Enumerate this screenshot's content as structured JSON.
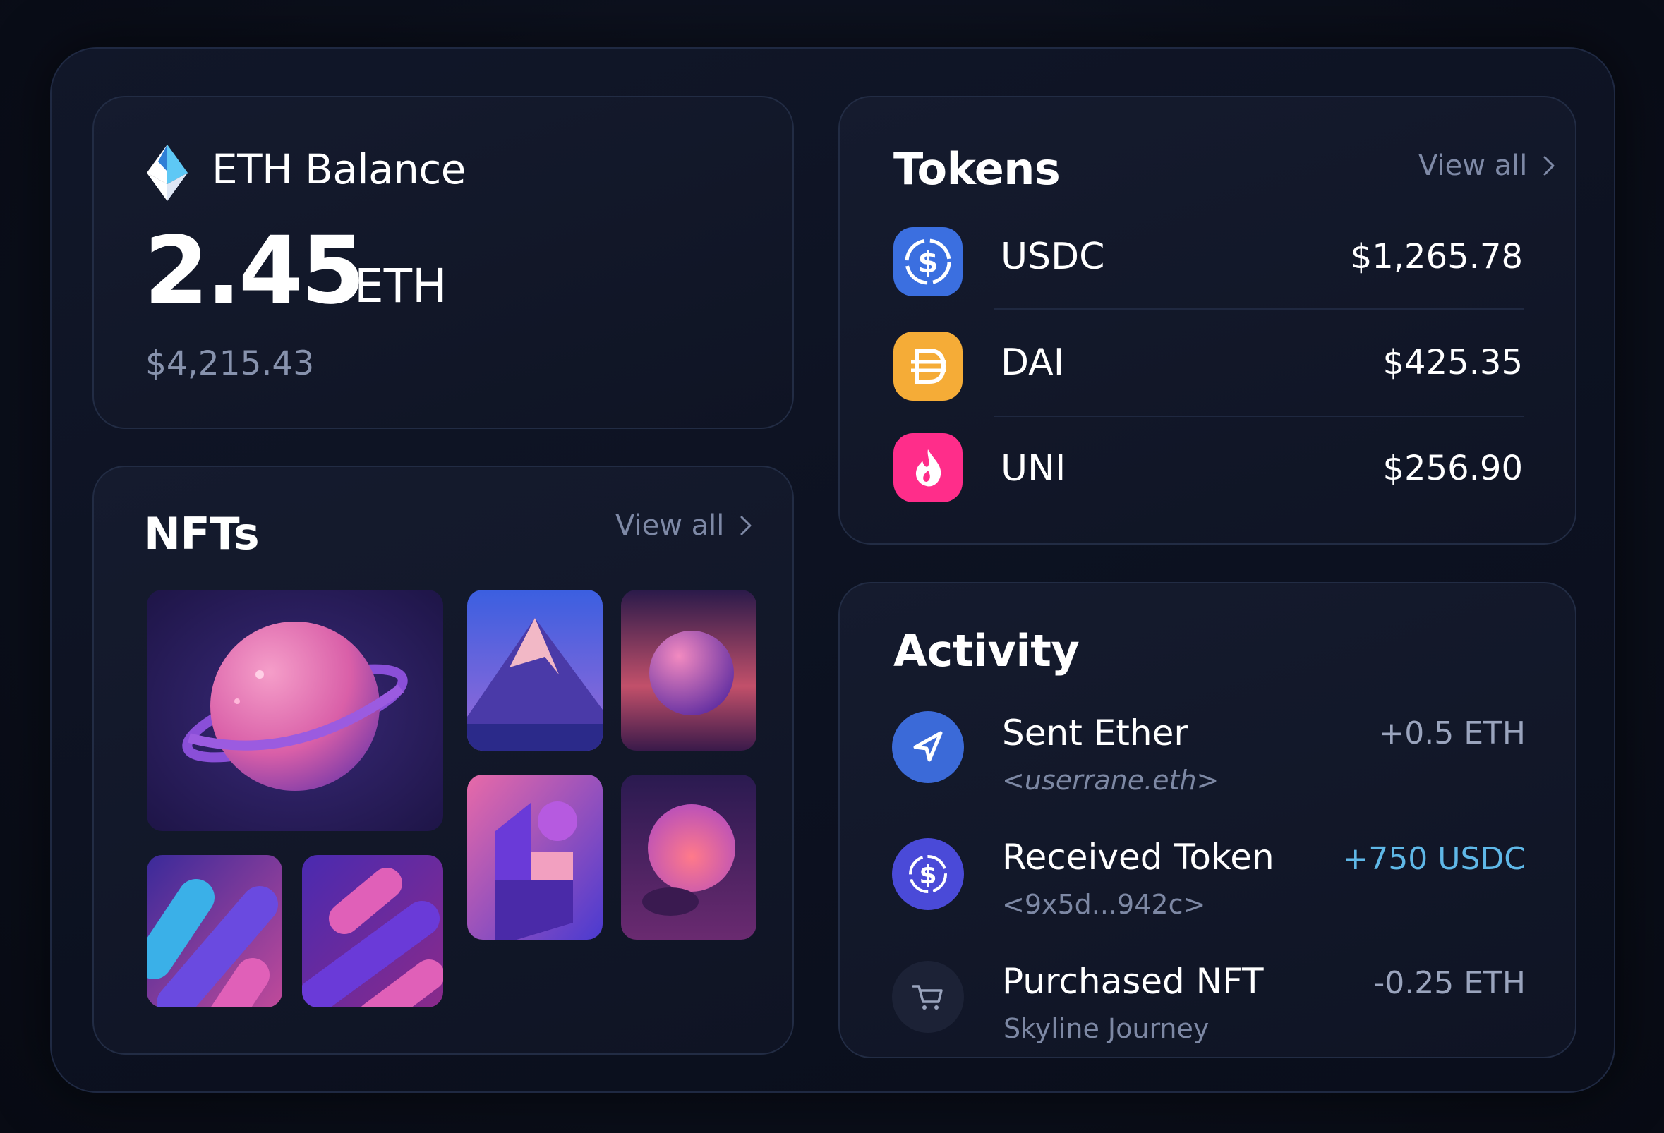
{
  "eth_balance": {
    "title": "ETH Balance",
    "amount": "2.45",
    "unit": "ETH",
    "usd": "$4,215.43"
  },
  "tokens": {
    "title": "Tokens",
    "view_all": "View all",
    "items": [
      {
        "name": "USDC",
        "value": "$1,265.78",
        "icon": "usdc-icon",
        "color": "#3b6fe0"
      },
      {
        "name": "DAI",
        "value": "$425.35",
        "icon": "dai-icon",
        "color": "#f5ac37"
      },
      {
        "name": "UNI",
        "value": "$256.90",
        "icon": "uni-icon",
        "color": "#ff2d8a"
      }
    ]
  },
  "nfts": {
    "title": "NFTs",
    "view_all": "View all"
  },
  "activity": {
    "title": "Activity",
    "items": [
      {
        "title": "Sent Ether",
        "subtitle": "<userrane.eth>",
        "amount": "+0.5 ETH",
        "icon": "send-icon",
        "amount_color": "#9aa4bd"
      },
      {
        "title": "Received Token",
        "subtitle": "<9x5d...942c>",
        "amount": "+750 USDC",
        "icon": "usdc-receive-icon",
        "amount_color": "#5fb8e8"
      },
      {
        "title": "Purchased NFT",
        "subtitle": "Skyline Journey",
        "amount": "-0.25 ETH",
        "icon": "cart-icon",
        "amount_color": "#9aa4bd"
      }
    ]
  }
}
